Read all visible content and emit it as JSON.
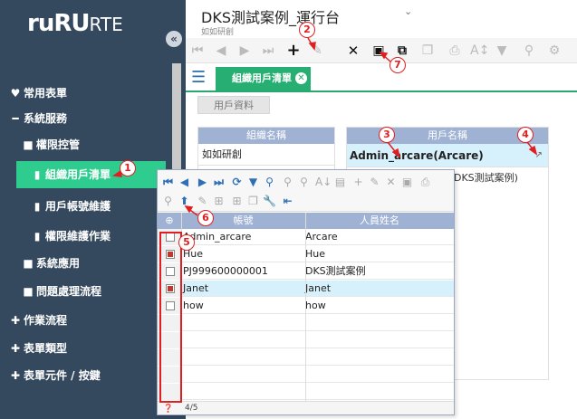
{
  "brand": {
    "name_main": "ruRU",
    "name_suffix": "RTE"
  },
  "header": {
    "title": "DKS測試案例_運行台",
    "subtitle": "如如研創"
  },
  "sidebar": {
    "items": [
      {
        "label": "常用表單",
        "icon": "heart-icon"
      },
      {
        "label": "系統服務",
        "icon": "minus-icon"
      },
      {
        "label": "權限控管",
        "icon": "folder-icon"
      },
      {
        "label": "組織用戶清單",
        "icon": "file-icon"
      },
      {
        "label": "用戶帳號維護",
        "icon": "file-icon"
      },
      {
        "label": "權限維護作業",
        "icon": "file-icon"
      },
      {
        "label": "系統應用",
        "icon": "folder-icon"
      },
      {
        "label": "問題處理流程",
        "icon": "folder-icon"
      },
      {
        "label": "作業流程",
        "icon": "plus-icon"
      },
      {
        "label": "表單類型",
        "icon": "plus-icon"
      },
      {
        "label": "表單元件 / 按鍵",
        "icon": "plus-icon"
      }
    ]
  },
  "tabs": {
    "active": "組織用戶清單",
    "sub": "用戶資料"
  },
  "left_panel": {
    "header": "組織名稱",
    "rows": [
      "如如研創"
    ]
  },
  "right_panel": {
    "header": "用戶名稱",
    "rows": [
      "Admin_arcare(Arcare)",
      "DKS測試案例)"
    ]
  },
  "popup": {
    "columns": [
      "帳號",
      "人員姓名"
    ],
    "rows": [
      {
        "account": "Admin_arcare",
        "name": "Arcare",
        "checked": false
      },
      {
        "account": "Hue",
        "name": "Hue",
        "checked": true
      },
      {
        "account": "PJ999600000001",
        "name": "DKS測試案例",
        "checked": false
      },
      {
        "account": "Janet",
        "name": "Janet",
        "checked": true
      },
      {
        "account": "how",
        "name": "how",
        "checked": false
      }
    ],
    "pager": "4/5"
  },
  "annotations": [
    "1",
    "2",
    "3",
    "4",
    "5",
    "6",
    "7"
  ],
  "colors": {
    "sidebar_bg": "#34495e",
    "accent": "#27ae72",
    "grid_header": "#9fb2d4",
    "highlight": "#d6f1fb",
    "annotation": "#e02020"
  }
}
